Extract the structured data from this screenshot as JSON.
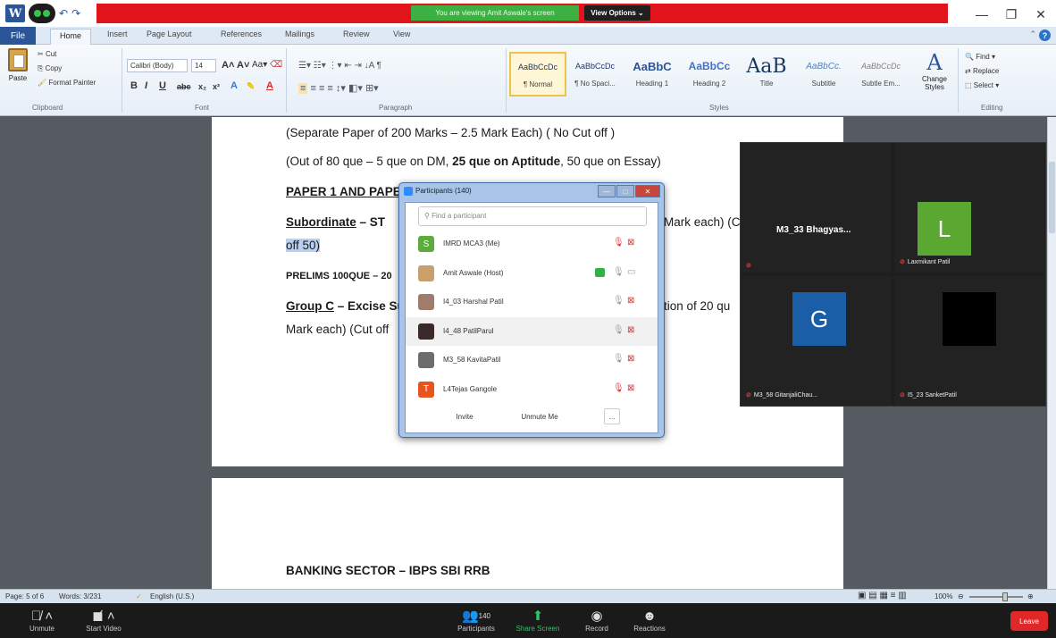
{
  "title_bar": {
    "sharing_notice": "You are viewing Amit Aswale's screen",
    "view_options": "View Options ⌄",
    "minimize": "—",
    "restore": "❐",
    "close": "✕"
  },
  "ribbon_tabs": [
    "File",
    "Home",
    "Insert",
    "Page Layout",
    "References",
    "Mailings",
    "Review",
    "View"
  ],
  "ribbon": {
    "paste": "Paste",
    "cut": "Cut",
    "copy": "Copy",
    "format_painter": "Format Painter",
    "font_name": "Calibri (Body)",
    "font_size": "14",
    "styles": [
      {
        "sample": "AaBbCcDc",
        "name": "¶ Normal"
      },
      {
        "sample": "AaBbCcDc",
        "name": "¶ No Spaci..."
      },
      {
        "sample": "AaBbC",
        "name": "Heading 1"
      },
      {
        "sample": "AaBbCc",
        "name": "Heading 2"
      },
      {
        "sample": "AaB",
        "name": "Title"
      },
      {
        "sample": "AaBbCc.",
        "name": "Subtitle"
      },
      {
        "sample": "AaBbCcDc",
        "name": "Subtle Em..."
      }
    ],
    "change_styles": "Change Styles",
    "find": "Find",
    "replace": "Replace",
    "select": "Select",
    "groups": [
      "Clipboard",
      "Font",
      "Paragraph",
      "Styles",
      "Editing"
    ]
  },
  "document": {
    "line1": "(Separate Paper of 200 Marks – 2.5 Mark Each) ( No Cut off )",
    "line2_a": "(Out of 80 que – 5 que on DM, ",
    "line2_b": "25 que on Aptitude",
    "line2_c": ", 50 que on Essay)",
    "line3": "PAPER 1 AND PAPE",
    "line4_a": "Subordinate",
    "line4_b": " – ",
    "line4_c": "ST",
    "line4_d": "Mark each) (C",
    "line5": "off 50)",
    "line6": "PRELIMS 100QUE – 20",
    "line7_a": "Group C",
    "line7_b": " – ",
    "line7_c": "Excise Su",
    "line7_d": "tion of 20 qu",
    "line8": "Mark each) (Cut off",
    "page2_heading": "BANKING SECTOR – IBPS SBI RRB"
  },
  "participants": {
    "title": "Participants (140)",
    "search_placeholder": "Find a participant",
    "rows": [
      {
        "initial": "S",
        "color": "#5cab3b",
        "name": "IMRD MCA3 (Me)",
        "mic": "🎙",
        "cam": "⊠"
      },
      {
        "initial": "",
        "color": "#c7a06b",
        "name": "Amit Aswale (Host)",
        "mic": "🎙",
        "cam": "▭"
      },
      {
        "initial": "",
        "color": "#a07c6a",
        "name": "I4_03 Harshal Patil",
        "mic": "🎙",
        "cam": "⊠"
      },
      {
        "initial": "",
        "color": "#3a2a2a",
        "name": "I4_48 PatilParul",
        "mic": "🎙",
        "cam": "⊠"
      },
      {
        "initial": "",
        "color": "#6d6d6d",
        "name": "M3_58 KavitaPatil",
        "mic": "🎙",
        "cam": "⊠"
      },
      {
        "initial": "T",
        "color": "#e8541e",
        "name": "L4Tejas Gangole",
        "mic": "🎙",
        "cam": "⊠"
      }
    ],
    "invite": "Invite",
    "unmute_me": "Unmute Me",
    "more": "..."
  },
  "gallery": {
    "tiles": [
      {
        "name": "M3_33 Bhagyas...",
        "label": "",
        "initial": "",
        "color": ""
      },
      {
        "name": "",
        "label": "Laxmikant Patil",
        "initial": "L",
        "color": "#5aa832"
      },
      {
        "name": "",
        "label": "M3_58 GitanjaliChau...",
        "initial": "G",
        "color": "#1a5ea8"
      },
      {
        "name": "",
        "label": "I5_23 SanketPatil",
        "initial": "",
        "color": "#000000"
      }
    ]
  },
  "status_bar": {
    "page": "Page: 5 of 6",
    "words": "Words: 3/231",
    "language": "English (U.S.)",
    "zoom": "100%"
  },
  "zoom_toolbar": {
    "unmute": "Unmute",
    "start_video": "Start Video",
    "participants_count": "140",
    "participants": "Participants",
    "share_screen": "Share Screen",
    "record": "Record",
    "reactions": "Reactions",
    "leave": "Leave"
  }
}
